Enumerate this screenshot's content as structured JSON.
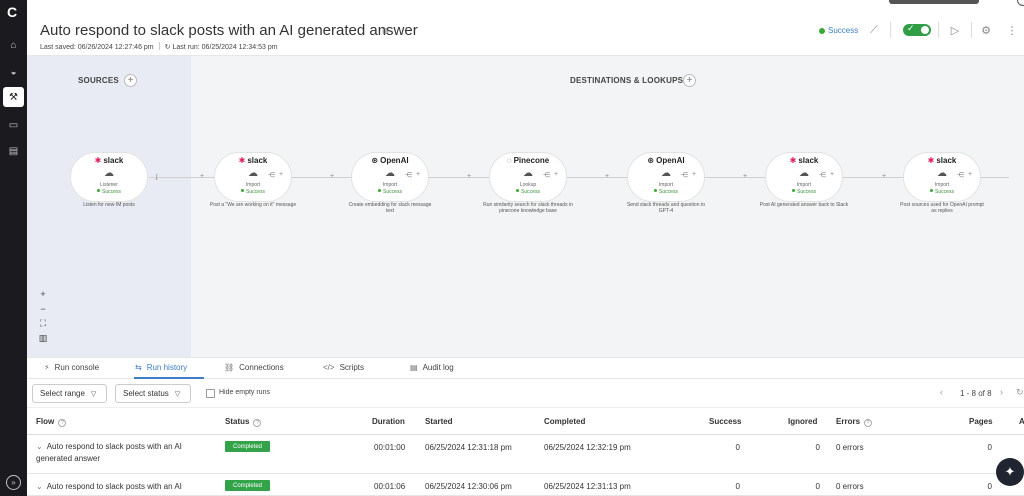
{
  "app": {
    "logo": "C"
  },
  "sidenav": {
    "items": [
      {
        "name": "home-icon",
        "glyph": "⌂"
      },
      {
        "name": "dashboard-icon",
        "glyph": "◒"
      },
      {
        "name": "tools-icon",
        "glyph": "⚒"
      },
      {
        "name": "folder-icon",
        "glyph": "▭"
      },
      {
        "name": "storage-icon",
        "glyph": "▤"
      }
    ],
    "bottom_glyph": "»"
  },
  "header": {
    "title": "Auto respond to slack posts with an AI generated answer",
    "title_menu_icon": "≡",
    "last_saved": "Last saved: 06/26/2024 12:27:46 pm",
    "last_run": "Last run: 06/25/2024 12:34:53 pm",
    "status": "Success",
    "toggle_check": "✓",
    "run_icon": "▷",
    "settings_icon": "⚙",
    "more_icon": "⋮",
    "chart_icon": "⟋"
  },
  "canvas": {
    "sources_title": "SOURCES",
    "destinations_title": "DESTINATIONS & LOOKUPS",
    "plus": "+",
    "nodes": [
      {
        "brand": "slack",
        "bullet": "✱",
        "kind": "Listener",
        "status": "Success",
        "desc": "Listen for new IM posts",
        "side_left": "",
        "side_right": ""
      },
      {
        "brand": "slack",
        "bullet": "✱",
        "kind": "Import",
        "status": "Success",
        "desc": "Post a \"We are working on it\" message",
        "side_left": "⋲",
        "side_right": "+"
      },
      {
        "brand": "OpenAI",
        "bullet": "⊛",
        "kind": "Import",
        "status": "Success",
        "desc": "Create embedding for slack message text",
        "side_left": "⋲",
        "side_right": "+"
      },
      {
        "brand": "Pinecone",
        "bullet": "◌",
        "kind": "Lookup",
        "status": "Success",
        "desc": "Run similarity search for slack threads in pinecone knowledge base",
        "side_left": "⋲",
        "side_right": "+"
      },
      {
        "brand": "OpenAI",
        "bullet": "⊛",
        "kind": "Import",
        "status": "Success",
        "desc": "Send slack threads and question to GPT-4",
        "side_left": "⋲",
        "side_right": "+"
      },
      {
        "brand": "slack",
        "bullet": "✱",
        "kind": "Import",
        "status": "Success",
        "desc": "Post AI generated answer back to Slack",
        "side_left": "⋲",
        "side_right": "+"
      },
      {
        "brand": "slack",
        "bullet": "✱",
        "kind": "Import",
        "status": "Success",
        "desc": "Post sources used for OpenAI prompt as replies",
        "side_left": "⋲",
        "side_right": "+"
      }
    ],
    "connector_plus": "+",
    "zoom": [
      "+",
      "−",
      "⛶",
      "▥"
    ]
  },
  "tabs": [
    {
      "icon": "⚡",
      "label": "Run console"
    },
    {
      "icon": "⇆",
      "label": "Run history"
    },
    {
      "icon": "⛓",
      "label": "Connections"
    },
    {
      "icon": "</>",
      "label": "Scripts"
    },
    {
      "icon": "▤",
      "label": "Audit log"
    }
  ],
  "filters": {
    "range": "Select range",
    "status": "Select status",
    "hide_empty": "Hide empty runs",
    "pager": "1 - 8 of 8",
    "prev": "‹",
    "next": "›",
    "refresh": "↻"
  },
  "table": {
    "headers": {
      "flow": "Flow",
      "status": "Status",
      "duration": "Duration",
      "started": "Started",
      "completed": "Completed",
      "success": "Success",
      "ignored": "Ignored",
      "errors": "Errors",
      "pages": "Pages",
      "more": "A"
    },
    "help": "?",
    "rows": [
      {
        "flow": "Auto respond to slack posts with an AI generated answer",
        "status": "Completed",
        "duration": "00:01:00",
        "started": "06/25/2024 12:31:18 pm",
        "completed": "06/25/2024 12:32:19 pm",
        "success": "0",
        "ignored": "0",
        "errors": "0 errors",
        "pages": "0"
      },
      {
        "flow": "Auto respond to slack posts with an AI",
        "status": "Completed",
        "duration": "00:01:06",
        "started": "06/25/2024 12:30:06 pm",
        "completed": "06/25/2024 12:31:13 pm",
        "success": "0",
        "ignored": "0",
        "errors": "0 errors",
        "pages": "0"
      }
    ],
    "caret": "⌄"
  },
  "fab_icon": "✦"
}
